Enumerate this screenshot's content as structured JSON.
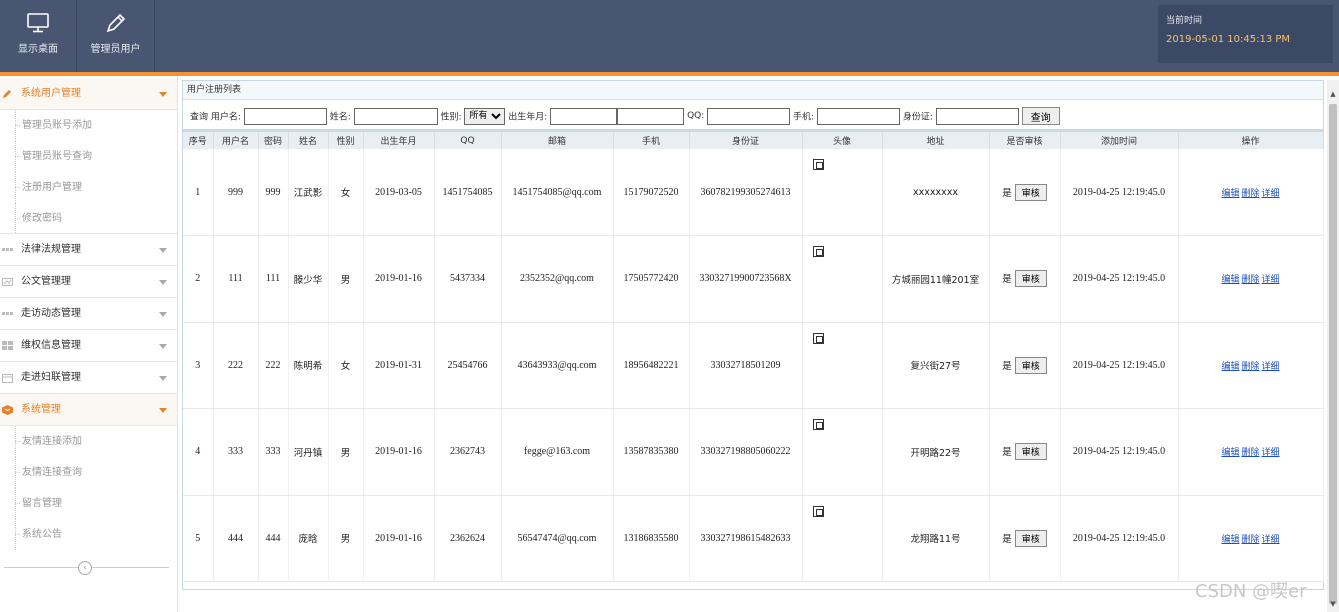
{
  "header": {
    "desktop_label": "显示桌面",
    "admin_label": "管理员用户",
    "time_label": "当前时间",
    "time_value": "2019-05-01 10:45:13 PM"
  },
  "sidebar": {
    "groups": [
      {
        "label": "系统用户管理",
        "items": [
          "管理员账号添加",
          "管理员账号查询",
          "注册用户管理",
          "修改密码"
        ]
      },
      {
        "label": "法律法规管理"
      },
      {
        "label": "公文管理理"
      },
      {
        "label": "走访动态管理"
      },
      {
        "label": "维权信息管理"
      },
      {
        "label": "走进妇联管理"
      },
      {
        "label": "系统管理",
        "items": [
          "友情连接添加",
          "友情连接查询",
          "留言管理",
          "系统公告"
        ]
      }
    ]
  },
  "main": {
    "title": "用户注册列表",
    "search": {
      "query_label": "查询",
      "username_label": "用户名:",
      "name_label": "姓名:",
      "gender_label": "性别:",
      "gender_value": "所有",
      "birth_label": "出生年月:",
      "qq_label": "QQ:",
      "phone_label": "手机:",
      "id_label": "身份证:",
      "search_button": "查询"
    },
    "columns": [
      "序号",
      "用户名",
      "密码",
      "姓名",
      "性别",
      "出生年月",
      "QQ",
      "邮箱",
      "手机",
      "身份证",
      "头像",
      "地址",
      "是否审核",
      "添加时间",
      "操作"
    ],
    "rows": [
      {
        "no": "1",
        "username": "999",
        "password": "999",
        "name": "江武影",
        "gender": "女",
        "birth": "2019-03-05",
        "qq": "1451754085",
        "email": "1451754085@qq.com",
        "phone": "15179072520",
        "idcard": "360782199305274613",
        "address": "xxxxxxxx",
        "audited": "是",
        "added": "2019-04-25 12:19:45.0"
      },
      {
        "no": "2",
        "username": "111",
        "password": "111",
        "name": "滕少华",
        "gender": "男",
        "birth": "2019-01-16",
        "qq": "5437334",
        "email": "2352352@qq.com",
        "phone": "17505772420",
        "idcard": "33032719900723568X",
        "address": "方城丽园11幢201室",
        "audited": "是",
        "added": "2019-04-25 12:19:45.0"
      },
      {
        "no": "3",
        "username": "222",
        "password": "222",
        "name": "陈明希",
        "gender": "女",
        "birth": "2019-01-31",
        "qq": "25454766",
        "email": "43643933@qq.com",
        "phone": "18956482221",
        "idcard": "33032718501209",
        "address": "复兴街27号",
        "audited": "是",
        "added": "2019-04-25 12:19:45.0"
      },
      {
        "no": "4",
        "username": "333",
        "password": "333",
        "name": "河丹镇",
        "gender": "男",
        "birth": "2019-01-16",
        "qq": "2362743",
        "email": "fegge@163.com",
        "phone": "13587835380",
        "idcard": "330327198805060222",
        "address": "开明路22号",
        "audited": "是",
        "added": "2019-04-25 12:19:45.0"
      },
      {
        "no": "5",
        "username": "444",
        "password": "444",
        "name": "庞晗",
        "gender": "男",
        "birth": "2019-01-16",
        "qq": "2362624",
        "email": "56547474@qq.com",
        "phone": "13186835580",
        "idcard": "330327198615482633",
        "address": "龙翔路11号",
        "audited": "是",
        "added": "2019-04-25 12:19:45.0"
      }
    ],
    "audit_button": "审核",
    "ops": [
      "编辑",
      "删除",
      "详细"
    ]
  },
  "watermark": "CSDN @喫er",
  "colors": {
    "header_bg": "#485671",
    "accent": "#f59233",
    "time_text": "#f3c469",
    "link": "#1a4fc0"
  }
}
